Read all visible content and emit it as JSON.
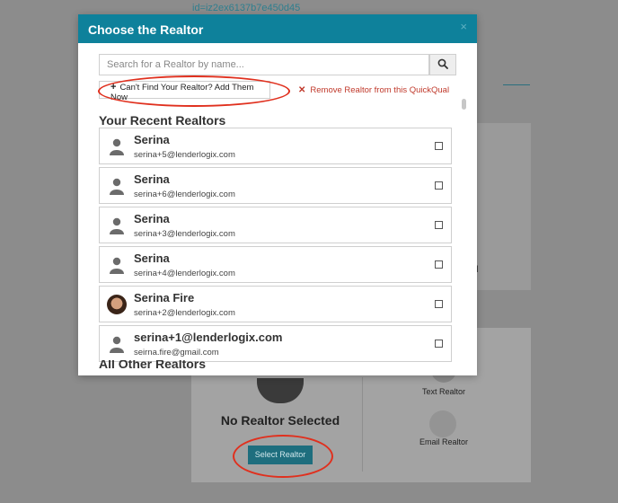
{
  "background": {
    "id_text": "id=iz2ex6137b7e450d45",
    "no_realtor_label": "No Realtor Selected",
    "select_button_label": "Select Realtor",
    "text_realtor_label": "Text Realtor",
    "email_realtor_label": "Email Realtor",
    "partial_letter": "d"
  },
  "modal": {
    "title": "Choose the Realtor",
    "close_glyph": "×",
    "search": {
      "placeholder": "Search for a Realtor by name...",
      "value": ""
    },
    "add_button_label": "Can't Find Your Realtor? Add Them Now",
    "remove_button_label": "Remove Realtor from this QuickQual",
    "recent_section_title": "Your Recent Realtors",
    "other_section_title": "All Other Realtors",
    "recent_realtors": [
      {
        "name": "Serina",
        "email": "serina+5@lenderlogix.com",
        "avatar": "person-placeholder-icon",
        "checked": false
      },
      {
        "name": "Serina",
        "email": "serina+6@lenderlogix.com",
        "avatar": "person-placeholder-icon",
        "checked": false
      },
      {
        "name": "Serina",
        "email": "serina+3@lenderlogix.com",
        "avatar": "person-placeholder-icon",
        "checked": false
      },
      {
        "name": "Serina",
        "email": "serina+4@lenderlogix.com",
        "avatar": "person-placeholder-icon",
        "checked": false
      },
      {
        "name": "Serina Fire",
        "email": "serina+2@lenderlogix.com",
        "avatar": "profile-photo",
        "checked": false
      },
      {
        "name": "serina+1@lenderlogix.com",
        "email": "seirna.fire@gmail.com",
        "avatar": "person-placeholder-icon",
        "checked": false
      }
    ]
  },
  "colors": {
    "header_teal": "#0e819b",
    "remove_red": "#c0392b",
    "annotation_red": "#e0301e",
    "overlay_gray": "#8c8c8c"
  }
}
